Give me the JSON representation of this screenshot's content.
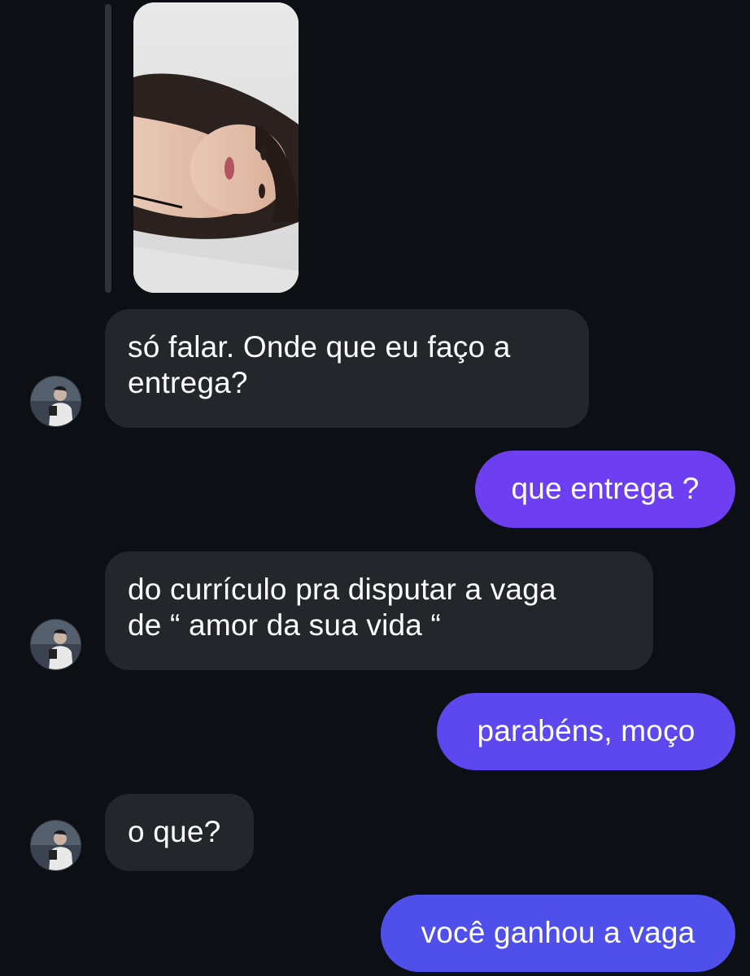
{
  "conversation": {
    "messages": [
      {
        "id": "m1",
        "direction": "incoming",
        "lines": [
          "só falar. Onde que eu faço a",
          "entrega?"
        ]
      },
      {
        "id": "m2",
        "direction": "outgoing",
        "lines": [
          "que entrega ?"
        ]
      },
      {
        "id": "m3",
        "direction": "incoming",
        "lines": [
          "do currículo pra disputar a vaga",
          "de “ amor da sua vida “"
        ]
      },
      {
        "id": "m4",
        "direction": "outgoing",
        "lines": [
          "parabéns, moço"
        ]
      },
      {
        "id": "m5",
        "direction": "incoming",
        "lines": [
          "o que?"
        ]
      },
      {
        "id": "m6",
        "direction": "outgoing",
        "lines": [
          "você ganhou a vaga"
        ]
      }
    ]
  },
  "colors": {
    "background": "#0c0f14",
    "incoming_bubble": "#23262b",
    "outgoing_bubble_top": "#7a3cf0",
    "outgoing_bubble_bottom": "#4d52ec",
    "reply_bar": "#2f3237",
    "text": "#ffffff"
  },
  "icons": {
    "reply_photo": "replied-story-photo",
    "avatar": "contact-avatar-icon"
  }
}
